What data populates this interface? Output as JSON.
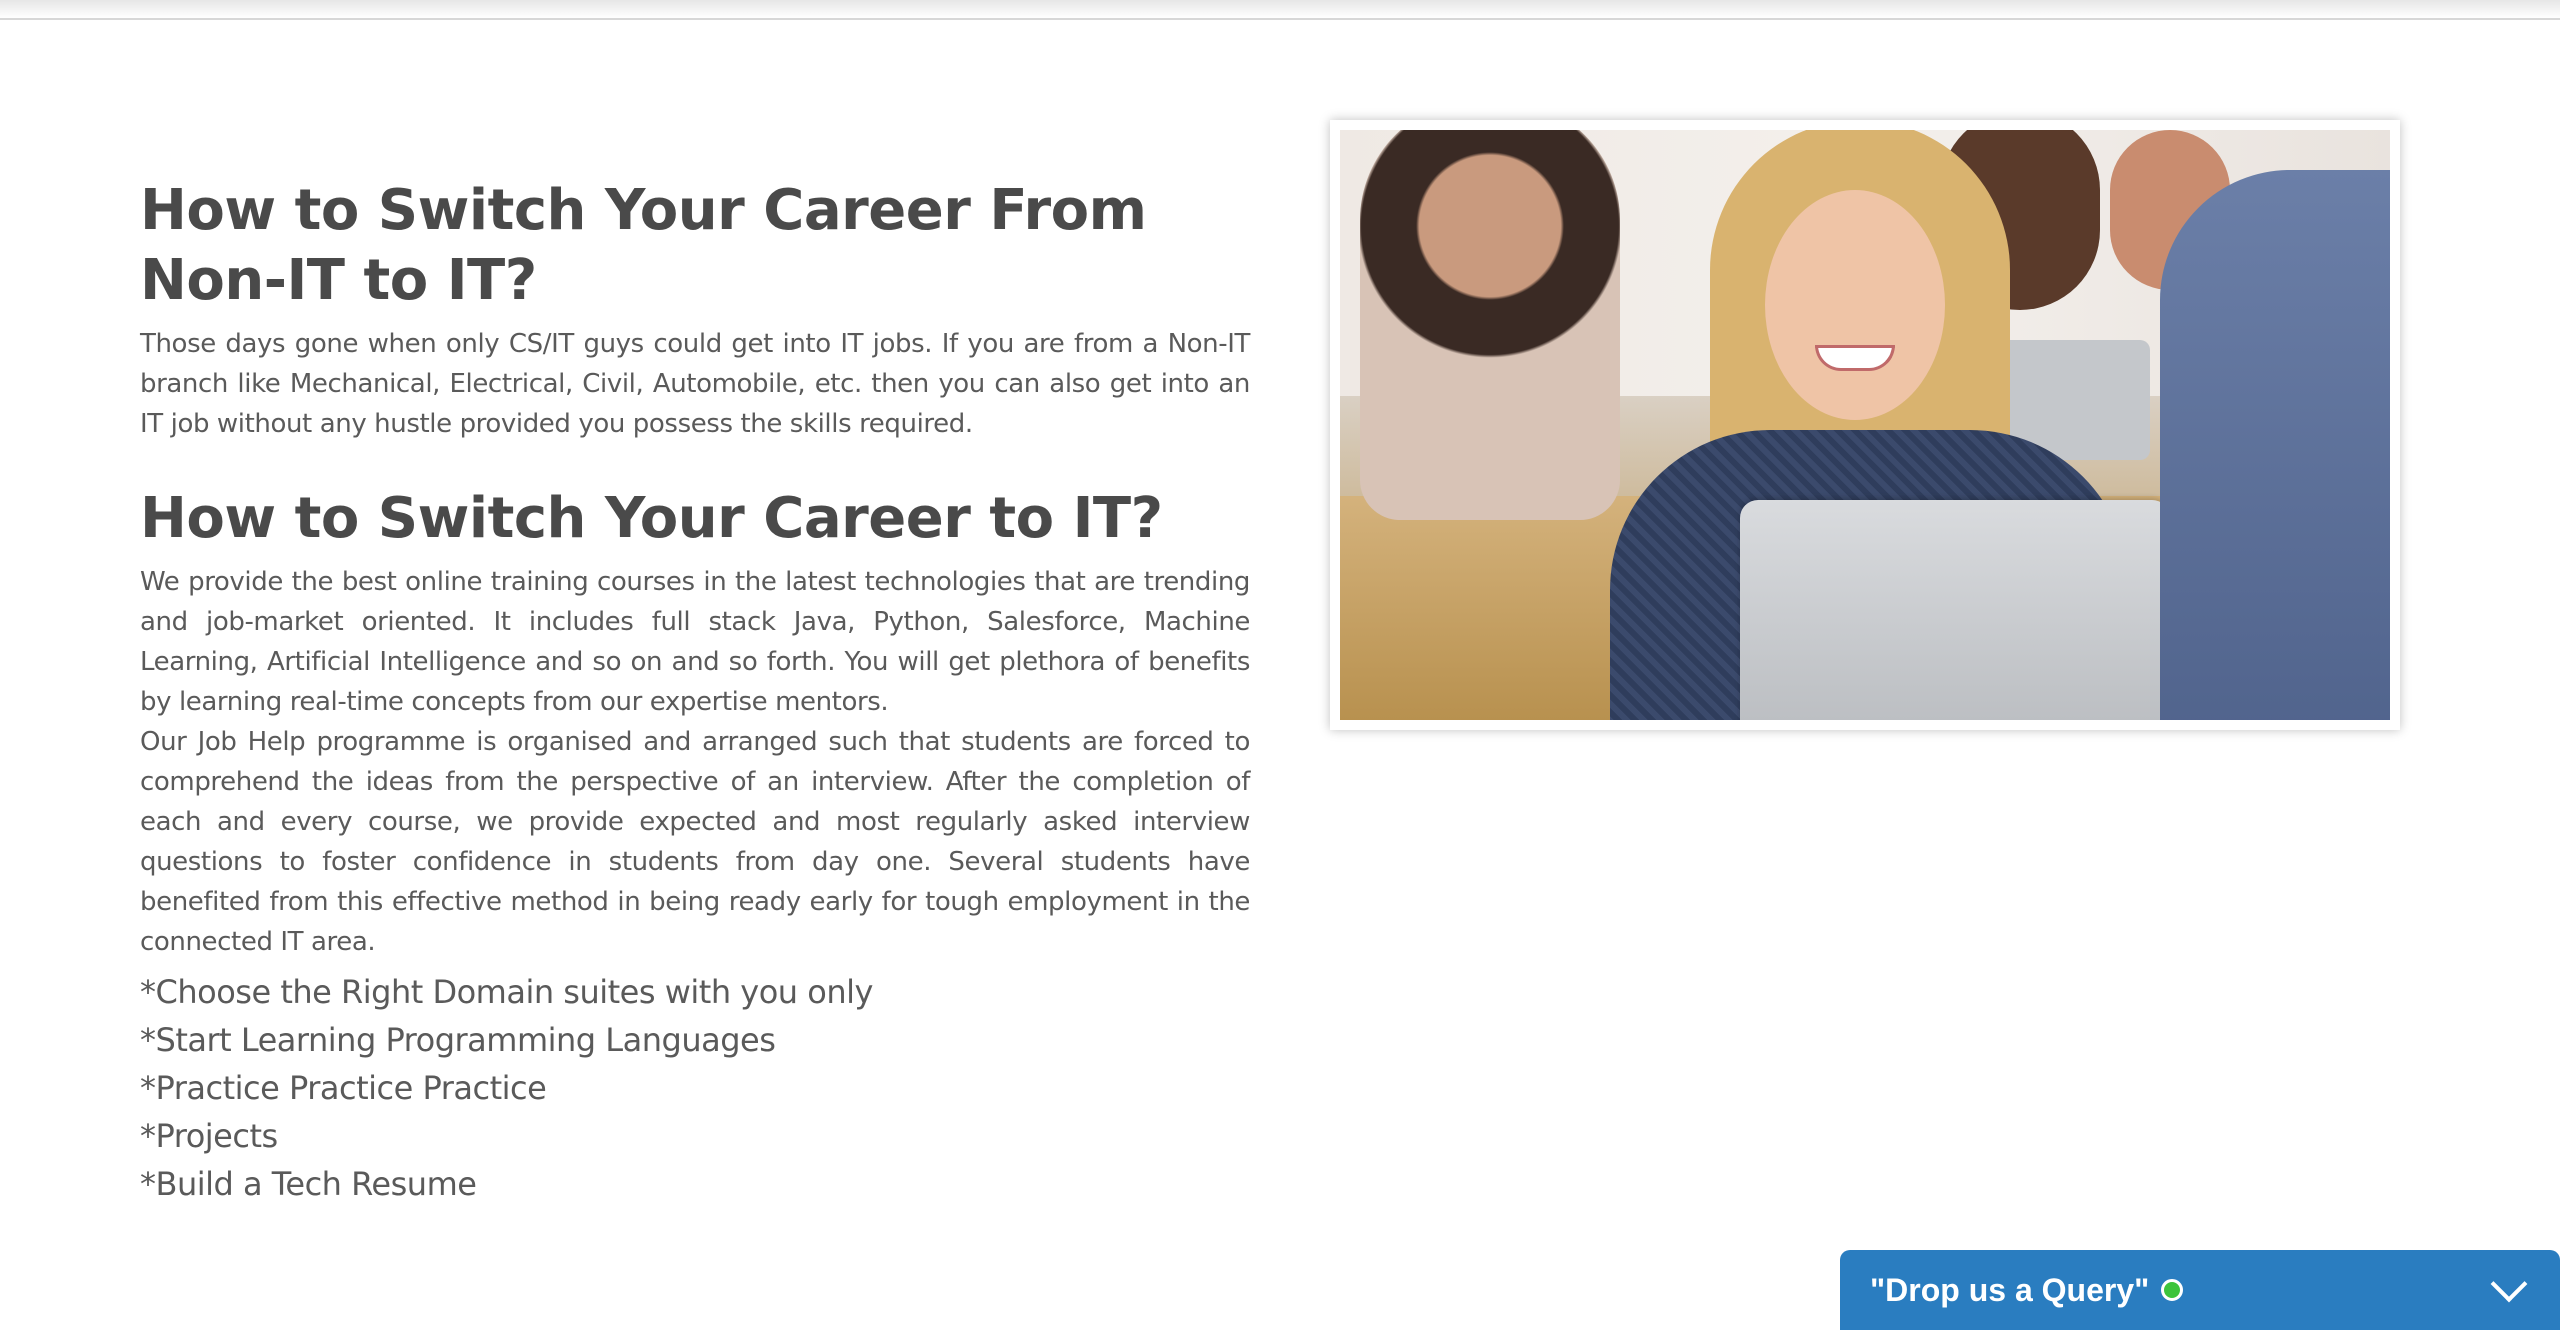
{
  "article": {
    "heading1": "How to Switch Your Career From Non-IT to IT?",
    "para1": "Those days gone when only CS/IT guys could get into IT jobs. If you are from a Non-IT branch like Mechanical, Electrical, Civil, Automobile, etc. then you can also get into an IT job without any hustle provided you possess the skills required.",
    "heading2": "How to Switch Your Career to IT?",
    "para2": "We provide the best online training courses in the latest technologies that are trending and job-market oriented. It includes full stack Java, Python, Salesforce, Machine Learning, Artificial Intelligence and so on and so forth. You will get plethora of benefits by learning real-time concepts from our expertise mentors.",
    "para3": "Our Job Help programme is organised and arranged such that students are forced to comprehend the ideas from the perspective of an interview. After the completion of each and every course, we provide expected and most regularly asked interview questions to foster confidence in students from day one. Several students have benefited from this effective method in being ready early for tough employment in the connected IT area.",
    "steps": [
      "*Choose the Right Domain suites with you only",
      "*Start Learning Programming Languages",
      "*Practice Practice Practice",
      "*Projects",
      "*Build a Tech Resume"
    ]
  },
  "chat": {
    "title": "\"Drop us a Query\"",
    "status_color": "#3cc43c",
    "background_color": "#2a7dc0"
  },
  "icons": {
    "status": "online-dot-icon",
    "toggle": "chevron-down-icon"
  }
}
